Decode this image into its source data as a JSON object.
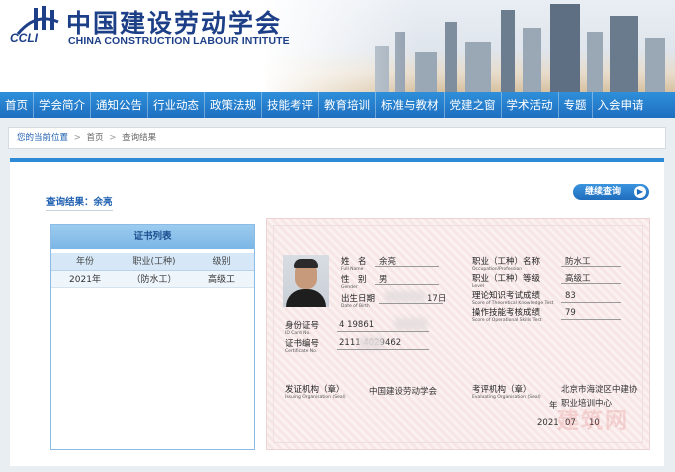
{
  "header": {
    "cn_title": "中国建设劳动学会",
    "en_title": "CHINA CONSTRUCTION LABOUR INTITUTE",
    "logo_text": "CCLI"
  },
  "nav": [
    "首页",
    "学会简介",
    "通知公告",
    "行业动态",
    "政策法规",
    "技能考评",
    "教育培训",
    "标准与教材",
    "党建之窗",
    "学术活动",
    "专题",
    "入会申请"
  ],
  "breadcrumb": {
    "here": "您的当前位置",
    "sep": ">",
    "home": "首页",
    "current": "查询结果"
  },
  "result_title": "查询结果：余亮",
  "continue_label": "继续查询",
  "cert_list": {
    "title": "证书列表",
    "columns": [
      "年份",
      "职业(工种)",
      "级别"
    ],
    "rows": [
      {
        "year": "2021年",
        "occupation": "（防水工）",
        "level": "高级工"
      }
    ]
  },
  "certificate": {
    "name_label": "姓　名",
    "name_en": "Full Name",
    "name_value": "余亮",
    "gender_label": "性　别",
    "gender_en": "Gender",
    "gender_value": "男",
    "dob_label": "出生日期",
    "dob_en": "Date of Birth",
    "dob_value": "17日",
    "id_label": "身份证号",
    "id_en": "ID Card No.",
    "id_value": "4      19861",
    "certno_label": "证书编号",
    "certno_en": "Certificate No.",
    "certno_value": "2111         4029462",
    "occ_label": "职业（工种）名称",
    "occ_en": "Occupation/Profession",
    "occ_value": "防水工",
    "lvl_label": "职业（工种）等级",
    "lvl_en": "Level",
    "lvl_value": "高级工",
    "theory_label": "理论知识考试成绩",
    "theory_en": "Score of Theoretical Knowledge Test",
    "theory_value": "83",
    "skill_label": "操作技能考核成绩",
    "skill_en": "Score of Operational Skills Test",
    "skill_value": "79",
    "issue_label": "发证机构（章）",
    "issue_en": "Issuing Organisation (Seal)",
    "issue_value": "中国建设劳动学会",
    "eval_label": "考评机构（章）",
    "eval_en": "Evaluating Organisation (Seal)",
    "eval_value_1": "北京市海淀区中建协",
    "eval_value_2": "职业培训中心",
    "year_suffix": "年",
    "date_year": "2021",
    "date_month": "07",
    "date_day": "10",
    "watermark": "建筑网"
  }
}
